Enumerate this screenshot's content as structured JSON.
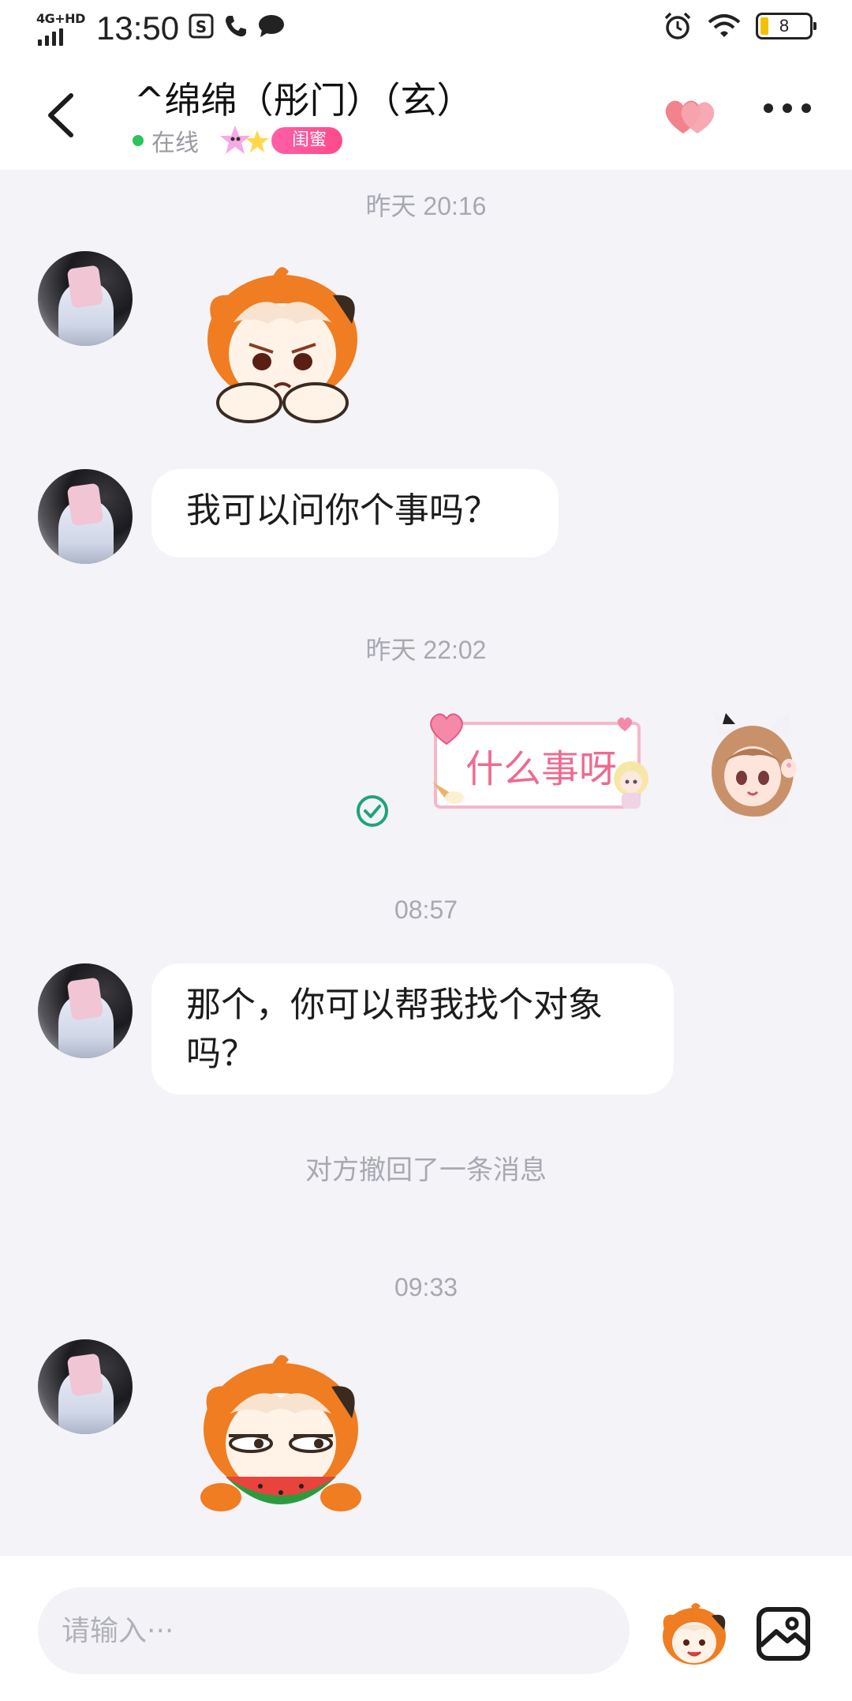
{
  "status_bar": {
    "network": "4G+HD",
    "time": "13:50",
    "battery": "8"
  },
  "header": {
    "contact_name": "^绵绵（彤门）（玄）",
    "presence": "在线",
    "relation_badge": "闺蜜"
  },
  "messages": [
    {
      "type": "time",
      "text": "昨天 20:16"
    },
    {
      "type": "sticker",
      "from": "other",
      "sticker": "sad-pumpkin-sticker"
    },
    {
      "type": "text",
      "from": "other",
      "text": "我可以问你个事吗？"
    },
    {
      "type": "time",
      "text": "昨天 22:02"
    },
    {
      "type": "sticker",
      "from": "self",
      "text": "什么事呀",
      "status": "read"
    },
    {
      "type": "time",
      "text": "08:57"
    },
    {
      "type": "text",
      "from": "other",
      "line1": "那个，你可以帮我找个对象",
      "line2": "吗？"
    },
    {
      "type": "system",
      "text": "对方撤回了一条消息"
    },
    {
      "type": "time",
      "text": "09:33"
    },
    {
      "type": "sticker",
      "from": "other",
      "sticker": "watermelon-pumpkin-sticker"
    }
  ],
  "input": {
    "placeholder": "请输入···"
  },
  "colors": {
    "accent_pink": "#ff4a8a",
    "online_green": "#2ac45a",
    "background": "#f3f3f8"
  }
}
